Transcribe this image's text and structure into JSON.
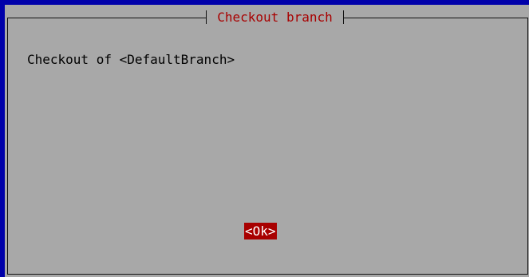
{
  "dialog": {
    "title": "Checkout branch",
    "message": "Checkout of <DefaultBranch>",
    "ok_label": "<Ok>"
  },
  "colors": {
    "screen_background": "#0000aa",
    "dialog_background": "#a8a8a8",
    "title_text": "#a80000",
    "button_background": "#a80000",
    "button_text": "#ffffff"
  }
}
